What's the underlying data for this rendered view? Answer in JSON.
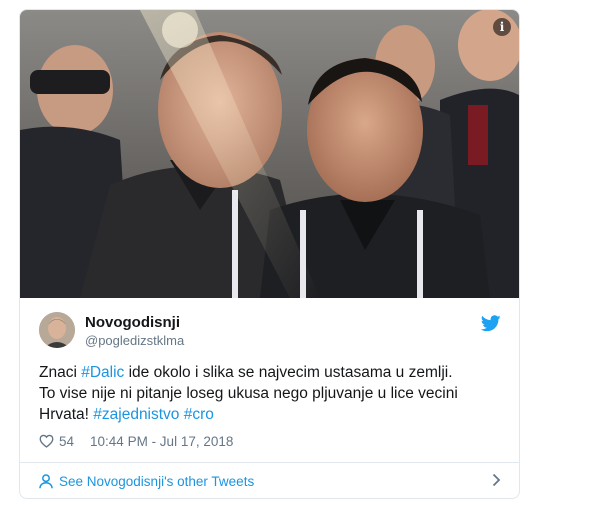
{
  "tweet": {
    "display_name": "Novogodisnji",
    "handle": "@pogledizstklma",
    "text_parts": {
      "p1": "Znaci ",
      "tag1": "#Dalic",
      "p2": " ide okolo i slika se najvecim ustasama u zemlji.",
      "p3": "To vise nije ni pitanje loseg ukusa nego pljuvanje u lice vecini",
      "p4": "Hrvata! ",
      "tag2": "#zajednistvo",
      "p5": " ",
      "tag3": "#cro"
    },
    "likes": "54",
    "timestamp": "10:44 PM - Jul 17, 2018",
    "other_tweets_label": "See Novogodisnji's other Tweets"
  },
  "icons": {
    "info": "info-icon",
    "twitter": "twitter-bird-icon",
    "like": "heart-icon",
    "person": "person-icon",
    "chevron": "chevron-right-icon"
  },
  "colors": {
    "link": "#1b95e0",
    "secondary_text": "#657786",
    "primary_text": "#14171a",
    "border": "#e1e8ed"
  }
}
